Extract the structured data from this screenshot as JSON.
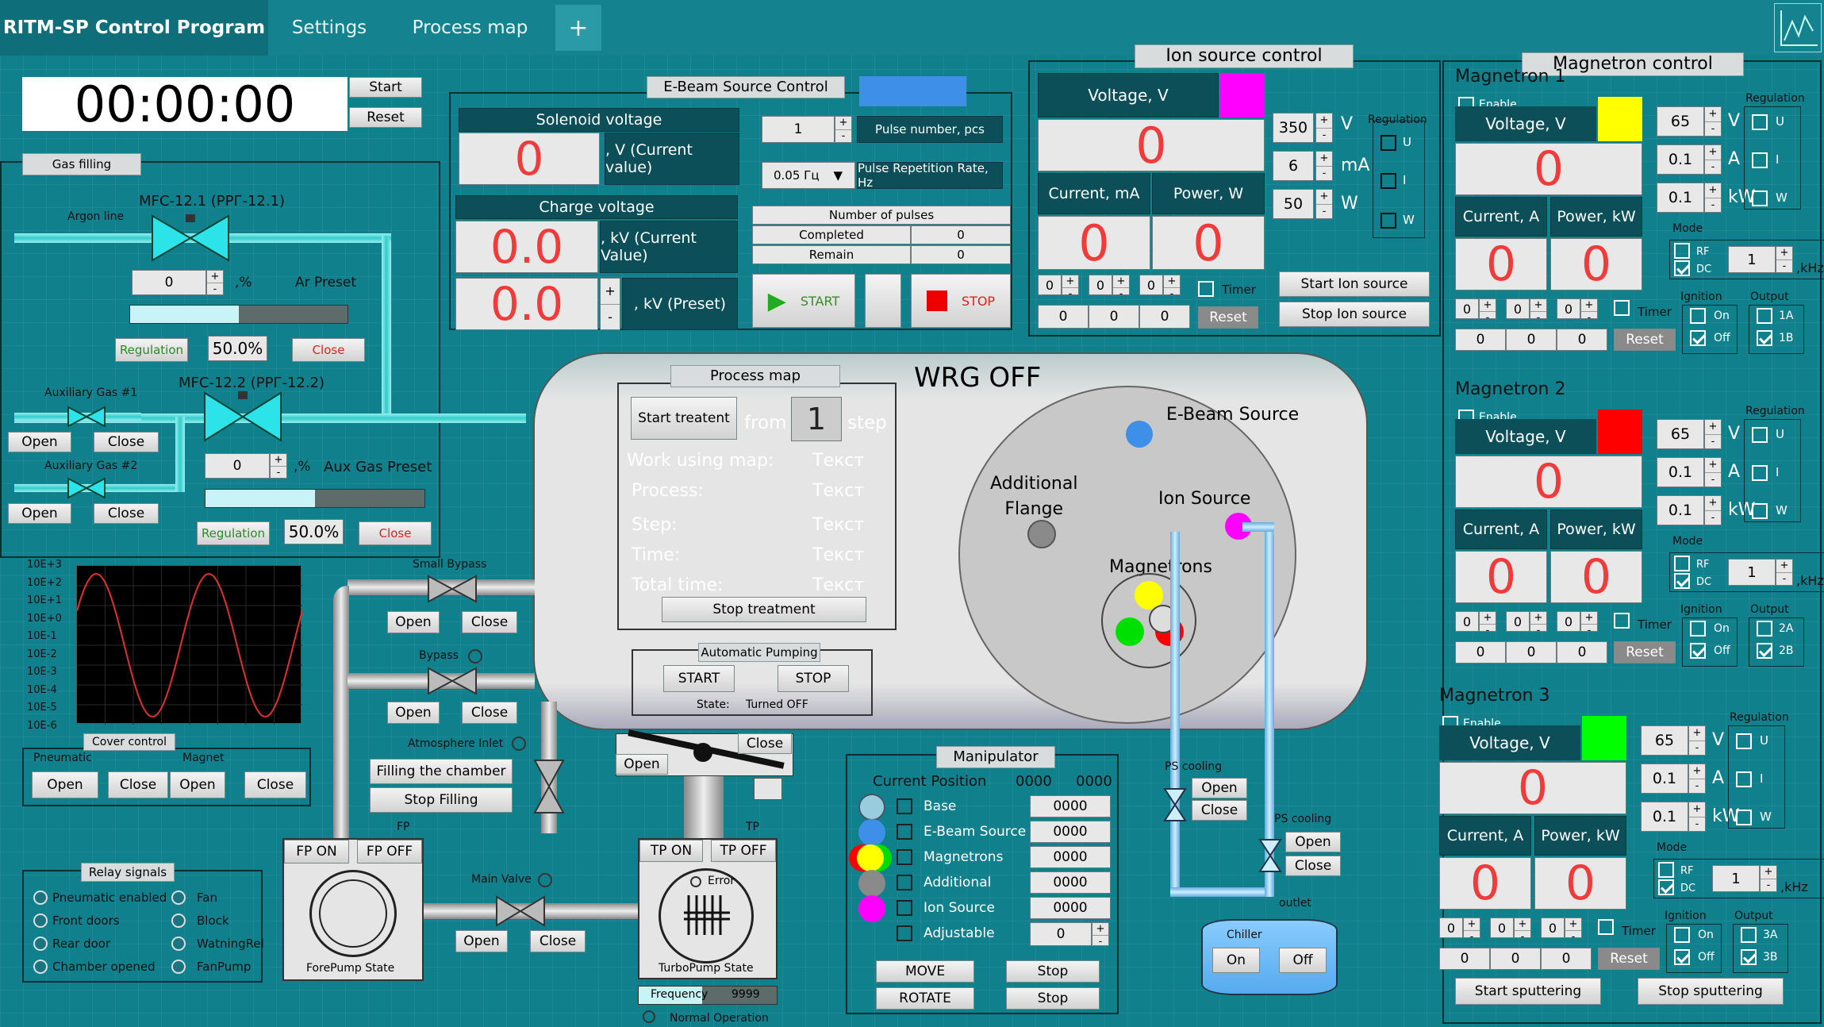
{
  "tabs": {
    "program": "RITM-SP Control Program",
    "settings": "Settings",
    "process_map": "Process map",
    "add": "+"
  },
  "timer": {
    "display": "00:00:00",
    "start": "Start",
    "reset": "Reset"
  },
  "gas": {
    "title": "Gas filling",
    "argon_line": "Argon line",
    "mfc1": "MFC-12.1 (РРГ-12.1)",
    "ar_value": "0",
    "ar_unit": ",%",
    "ar_preset": "Ar Preset",
    "regulation": "Regulation",
    "pct1": "50.0%",
    "pct1_fill": 0.5,
    "close": "Close",
    "mfc2": "MFC-12.2 (РРГ-12.2)",
    "aux1": "Auxiliary Gas #1",
    "aux2": "Auxiliary Gas #2",
    "open": "Open",
    "aux_value": "0",
    "aux_unit": ",%",
    "aux_preset": "Aux Gas Preset",
    "pct2": "50.0%",
    "pct2_fill": 0.5
  },
  "plot": {
    "labels": [
      "10E+3",
      "10E+2",
      "10E+1",
      "10E+0",
      "10E-1",
      "10E-2",
      "10E-3",
      "10E-4",
      "10E-5",
      "10E-6"
    ]
  },
  "cover": {
    "title": "Cover control",
    "pneumatic": "Pneumatic",
    "magnet": "Magnet",
    "open": "Open",
    "close": "Close"
  },
  "relay": {
    "title": "Relay signals",
    "items": [
      "Pneumatic enabled",
      "Front doors",
      "Rear door",
      "Chamber opened"
    ],
    "items2": [
      "Fan",
      "Block",
      "WatningRel",
      "FanPump"
    ]
  },
  "ebeam": {
    "title": "E-Beam Source Control",
    "color": "#3d8fe8",
    "solenoid": "Solenoid voltage",
    "sol_value": "0",
    "sol_unit": ", V (Current value)",
    "charge": "Charge voltage",
    "charge_value": "0.0",
    "charge_unit": ", kV  (Current Value)",
    "preset_value": "0.0",
    "preset_unit": ", kV      (Preset)",
    "pulse_n": "1",
    "pulse_label": "Pulse number, pcs",
    "rate": "0.05 Гц",
    "rate_label": "Pulse Repetition Rate, Hz",
    "np_title": "Number of pulses",
    "completed": "Completed",
    "completed_v": "0",
    "remain": "Remain",
    "remain_v": "0",
    "start": "START",
    "stop": "STOP"
  },
  "ion": {
    "title": "Ion source control",
    "voltage": "Voltage, V",
    "color": "#ff00ff",
    "value": "0",
    "current": "Current, mA",
    "power": "Power, W",
    "cur_v": "0",
    "pow_v": "0",
    "v_set": "350",
    "v_unit": "V",
    "ma_set": "6",
    "ma_unit": "mA",
    "w_set": "50",
    "w_unit": "W",
    "regulation": "Regulation",
    "reg": [
      "U",
      "I",
      "W"
    ],
    "t": [
      "0",
      "0",
      "0"
    ],
    "timer": "Timer",
    "r": [
      "0",
      "0",
      "0"
    ],
    "reset": "Reset",
    "start": "Start Ion source",
    "stop": "Stop Ion source"
  },
  "mag": {
    "title": "Magnetron control",
    "enable": "Enable",
    "voltage": "Voltage, V",
    "current": "Current, A",
    "power": "Power, kW",
    "regulation": "Regulation",
    "reg": [
      "U",
      "I",
      "W"
    ],
    "mode": "Mode",
    "rf": "RF",
    "dc": "DC",
    "khz": ",kHz",
    "ignition": "Ignition",
    "on": "On",
    "off": "Off",
    "output": "Output",
    "timer": "Timer",
    "reset": "Reset",
    "m1": {
      "name": "Magnetron 1",
      "color": "#ffff00",
      "v": "0",
      "c": "0",
      "p": "0",
      "s1": "65",
      "s2": "0.1",
      "s3": "0.1",
      "u1": "V",
      "u2": "A",
      "u3": "kW",
      "freq": "1",
      "o1": "1A",
      "o2": "1B"
    },
    "m2": {
      "name": "Magnetron 2",
      "color": "#ff0000",
      "v": "0",
      "c": "0",
      "p": "0",
      "s1": "65",
      "s2": "0.1",
      "s3": "0.1",
      "u1": "V",
      "u2": "A",
      "u3": "kW",
      "freq": "1",
      "o1": "2A",
      "o2": "2B"
    },
    "m3": {
      "name": "Magnetron 3",
      "color": "#00ff00",
      "v": "0",
      "c": "0",
      "p": "0",
      "s1": "65",
      "s2": "0.1",
      "s3": "0.1",
      "u1": "V",
      "u2": "A",
      "u3": "kW",
      "freq": "1",
      "o1": "3A",
      "o2": "3B"
    },
    "zero": "0",
    "start": "Start sputtering",
    "stop": "Stop sputtering"
  },
  "chamber": {
    "status": "WRG OFF",
    "ebeam": "E-Beam Source",
    "flange": "Additional\nFlange",
    "ion": "Ion Source",
    "magnetrons": "Magnetrons"
  },
  "pm": {
    "title": "Process map",
    "start": "Start treatent",
    "from": "from",
    "step_num": "1",
    "step": "step",
    "rows": [
      "Work using map:",
      "Process:",
      "Step:",
      "Time:",
      "Total time:"
    ],
    "vals": [
      "Текст",
      "Текст",
      "Текст",
      "Текст",
      "Текст"
    ],
    "stop": "Stop treatment"
  },
  "ap": {
    "title": "Automatic Pumping",
    "start": "START",
    "stop": "STOP",
    "state": "State:",
    "state_v": "Turned  OFF"
  },
  "vac": {
    "small_bypass": "Small Bypass",
    "bypass": "Bypass",
    "open": "Open",
    "close": "Close",
    "atm": "Atmosphere Inlet",
    "fill": "Filling the chamber",
    "stop_fill": "Stop Filling",
    "fp": "FP",
    "fp_on": "FP ON",
    "fp_off": "FP OFF",
    "fore": "ForePump State",
    "main": "Main Valve",
    "tp": "TP",
    "tp_on": "TP ON",
    "tp_off": "TP OFF",
    "error": "Error",
    "turbo": "TurboPump State",
    "freq": "Frequency",
    "freq_v": "9999",
    "normal": "Normal Operation"
  },
  "manip": {
    "title": "Manipulator",
    "cur_pos": "Current Position",
    "p1": "0000",
    "p2": "0000",
    "items": [
      "Base",
      "E-Beam Source",
      "Magnetrons",
      "Additional",
      "Ion Source",
      "Adjustable"
    ],
    "vals": [
      "0000",
      "0000",
      "0000",
      "0000",
      "0000",
      "0"
    ],
    "move": "MOVE",
    "rotate": "ROTATE",
    "stop": "Stop"
  },
  "cooling": {
    "ps": "PS cooling",
    "ps2": "PS cooling",
    "open": "Open",
    "close": "Close",
    "outlet": "outlet",
    "chiller": "Chiller",
    "on": "On",
    "off": "Off"
  }
}
